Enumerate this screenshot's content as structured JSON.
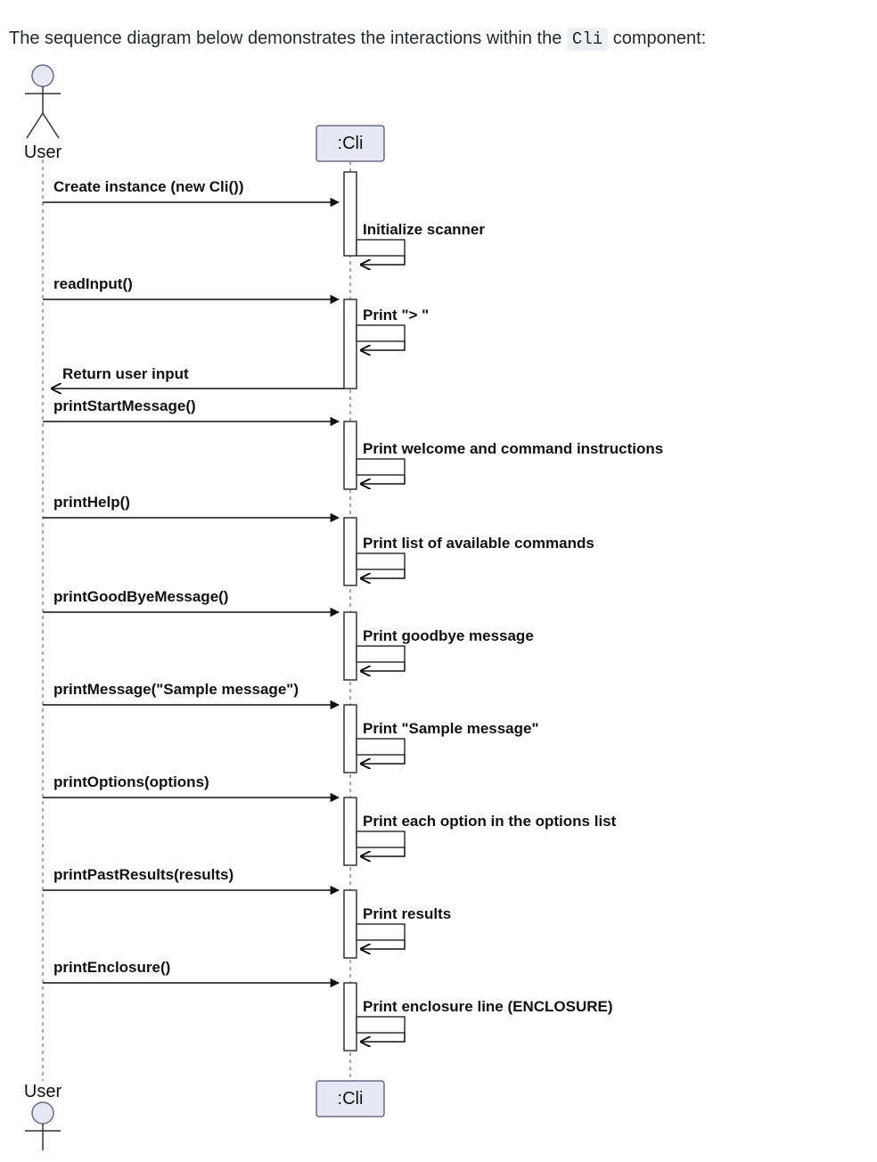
{
  "intro": {
    "prefix": "The sequence diagram below demonstrates the interactions within the ",
    "code": "Cli",
    "suffix": " component:"
  },
  "actor": {
    "label_top": "User",
    "label_bottom": "User"
  },
  "participant": {
    "label_top": ":Cli",
    "label_bottom": ":Cli"
  },
  "messages": [
    {
      "text": "Create instance (new Cli())"
    },
    {
      "text": "Initialize scanner"
    },
    {
      "text": "readInput()"
    },
    {
      "text": "Print \"> \""
    },
    {
      "text": "Return user input"
    },
    {
      "text": "printStartMessage()"
    },
    {
      "text": "Print welcome and command instructions"
    },
    {
      "text": "printHelp()"
    },
    {
      "text": "Print list of available commands"
    },
    {
      "text": "printGoodByeMessage()"
    },
    {
      "text": "Print goodbye message"
    },
    {
      "text": "printMessage(\"Sample message\")"
    },
    {
      "text": "Print \"Sample message\""
    },
    {
      "text": "printOptions(options)"
    },
    {
      "text": "Print each option in the options list"
    },
    {
      "text": "printPastResults(results)"
    },
    {
      "text": "Print results"
    },
    {
      "text": "printEnclosure()"
    },
    {
      "text": "Print enclosure line (ENCLOSURE)"
    }
  ]
}
